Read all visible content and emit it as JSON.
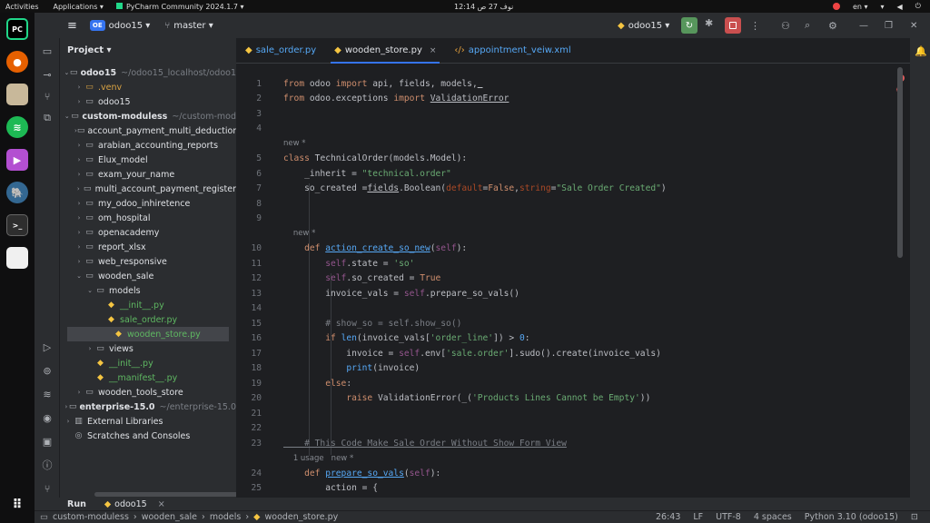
{
  "system_bar": {
    "activities": "Activities",
    "applications": "Applications ▾",
    "app_name": "PyCharm Community 2024.1.7 ▾",
    "clock": "12:14 نوف 27 ص",
    "lang": "en ▾"
  },
  "titlebar": {
    "project_badge": "OE",
    "project_name": "odoo15 ▾",
    "branch": "master ▾",
    "run_config": "odoo15 ▾"
  },
  "project_panel": {
    "title": "Project ▾",
    "rows": [
      {
        "label": "odoo15",
        "hint": "~/odoo15_localhost/odoo1",
        "bold": true
      },
      {
        "label": ".venv",
        "hint": ""
      },
      {
        "label": "odoo15",
        "hint": ""
      },
      {
        "label": "custom-moduless",
        "hint": "~/custom-mod",
        "bold": true
      },
      {
        "label": "account_payment_multi_deduction",
        "hint": ""
      },
      {
        "label": "arabian_accounting_reports",
        "hint": ""
      },
      {
        "label": "Elux_model",
        "hint": ""
      },
      {
        "label": "exam_your_name",
        "hint": ""
      },
      {
        "label": "multi_account_payment_register",
        "hint": ""
      },
      {
        "label": "my_odoo_inhiretence",
        "hint": ""
      },
      {
        "label": "om_hospital",
        "hint": ""
      },
      {
        "label": "openacademy",
        "hint": ""
      },
      {
        "label": "report_xlsx",
        "hint": ""
      },
      {
        "label": "web_responsive",
        "hint": ""
      },
      {
        "label": "wooden_sale",
        "hint": ""
      },
      {
        "label": "models",
        "hint": ""
      },
      {
        "label": "__init__.py",
        "hint": ""
      },
      {
        "label": "sale_order.py",
        "hint": ""
      },
      {
        "label": "wooden_store.py",
        "hint": ""
      },
      {
        "label": "views",
        "hint": ""
      },
      {
        "label": "__init__.py",
        "hint": ""
      },
      {
        "label": "__manifest__.py",
        "hint": ""
      },
      {
        "label": "wooden_tools_store",
        "hint": ""
      },
      {
        "label": "enterprise-15.0",
        "hint": "~/enterprise-15.0",
        "bold": true
      },
      {
        "label": "External Libraries",
        "hint": ""
      },
      {
        "label": "Scratches and Consoles",
        "hint": ""
      }
    ]
  },
  "tabs": [
    {
      "label": "sale_order.py"
    },
    {
      "label": "wooden_store.py",
      "close": "×"
    },
    {
      "label": "appointment_veiw.xml"
    }
  ],
  "code": [
    {
      "ln": "1",
      "text": "from odoo import api, fields, models, "
    },
    {
      "ln": "2",
      "text": "from odoo.exceptions import ValidationError"
    },
    {
      "ln": "3",
      "text": ""
    },
    {
      "ln": "4",
      "text": ""
    },
    {
      "ln": "",
      "text": "new *"
    },
    {
      "ln": "5",
      "text": "class TechnicalOrder(models.Model):"
    },
    {
      "ln": "6",
      "text": "    _inherit = \"technical.order\""
    },
    {
      "ln": "7",
      "text": "    so_created =fields.Boolean(default=False,string=\"Sale Order Created\")"
    },
    {
      "ln": "8",
      "text": ""
    },
    {
      "ln": "9",
      "text": ""
    },
    {
      "ln": "",
      "text": "new *"
    },
    {
      "ln": "10",
      "text": "    def action_create_so_new(self):"
    },
    {
      "ln": "11",
      "text": "        self.state = 'so'"
    },
    {
      "ln": "12",
      "text": "        self.so_created = True"
    },
    {
      "ln": "13",
      "text": "        invoice_vals = self.prepare_so_vals()"
    },
    {
      "ln": "14",
      "text": ""
    },
    {
      "ln": "15",
      "text": "        # show_so = self.show_so()"
    },
    {
      "ln": "16",
      "text": "        if len(invoice_vals['order_line']) > 0:"
    },
    {
      "ln": "17",
      "text": "            invoice = self.env['sale.order'].sudo().create(invoice_vals)"
    },
    {
      "ln": "18",
      "text": "            print(invoice)"
    },
    {
      "ln": "19",
      "text": "        else:"
    },
    {
      "ln": "20",
      "text": "            raise ValidationError(_('Products Lines Cannot be Empty'))"
    },
    {
      "ln": "21",
      "text": ""
    },
    {
      "ln": "22",
      "text": ""
    },
    {
      "ln": "23",
      "text": "    # This Code Make Sale Order Without Show Form View"
    },
    {
      "ln": "",
      "text": "1 usage   new *"
    },
    {
      "ln": "24",
      "text": "    def prepare_so_vals(self):"
    },
    {
      "ln": "25",
      "text": "        action = {"
    }
  ],
  "bottom": {
    "run": "Run",
    "run_tab": "odoo15",
    "run_close": "×"
  },
  "status": {
    "breadcrumb": [
      "custom-moduless",
      "wooden_sale",
      "models",
      "wooden_store.py"
    ],
    "position": "26:43",
    "line_sep": "LF",
    "encoding": "UTF-8",
    "indent": "4 spaces",
    "interpreter": "Python 3.10 (odoo15)"
  }
}
